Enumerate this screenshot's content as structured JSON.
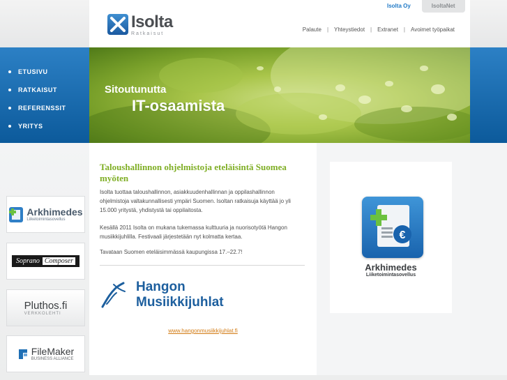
{
  "site_tabs": [
    {
      "label": "Isolta Oy",
      "active": true
    },
    {
      "label": "IsoltaNet",
      "active": false
    }
  ],
  "logo": {
    "name": "Isolta",
    "sub": "Ratkaisut"
  },
  "top_links": [
    "Palaute",
    "Yhteystiedot",
    "Extranet",
    "Avoimet työpaikat"
  ],
  "nav": [
    "ETUSIVU",
    "RATKAISUT",
    "REFERENSSIT",
    "YRITYS"
  ],
  "banner": {
    "line1": "Sitoutunutta",
    "line2": "IT-osaamista"
  },
  "main": {
    "headline": "Taloushallinnon ohjelmistoja eteläisintä Suomea myöten",
    "paragraphs": [
      "Isolta tuottaa taloushallinnon, asiakkuudenhallinnan ja oppilashallinnon ohjelmistoja valtakunnallisesti ympäri Suomen. Isoltan ratkaisuja käyttää jo yli 15.000 yritystä, yhdistystä tai oppilaitosta.",
      "Kesällä 2011 Isolta on mukana tukemassa kulttuuria ja nuorisotyötä Hangon musiikkijuhlilla. Festivaali järjestetään nyt kolmatta kertaa.",
      "Tavataan Suomen eteläisimmässä kaupungissa 17.–22.7!"
    ],
    "partner_logo": {
      "line1": "Hangon",
      "line2": "Musiikkijuhlat"
    },
    "link": "www.hangonmusiikkijuhlat.fi"
  },
  "side_logos": [
    {
      "name": "Arkhimedes",
      "sub": "Liiketoimintasovellus"
    },
    {
      "name": "Soprano",
      "name2": "Composer"
    },
    {
      "name": "Pluthos.fi",
      "sub": "VERKKOLEHTI"
    },
    {
      "name": "FileMaker",
      "sub": "BUSINESS ALLIANCE"
    }
  ],
  "ad": {
    "title": "Arkhimedes",
    "sub": "Liiketoimintasovellus"
  },
  "colors": {
    "accent_blue": "#1f79c6",
    "nav_blue": "#1a6cb0",
    "headline_green": "#7fae25",
    "link_orange": "#d27a12"
  }
}
